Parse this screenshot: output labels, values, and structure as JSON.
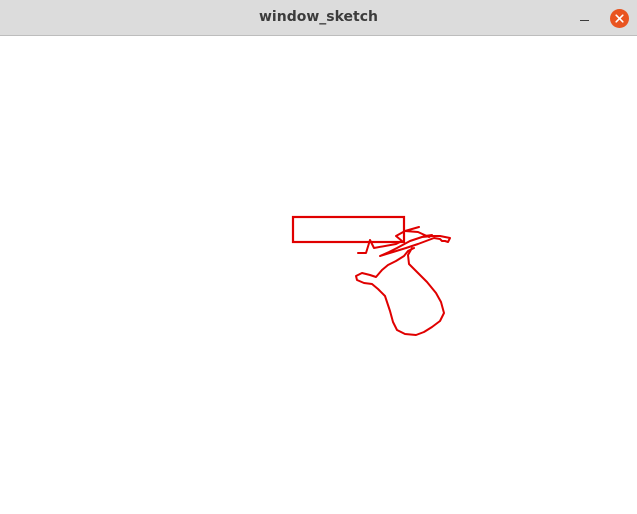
{
  "window": {
    "title": "window_sketch"
  },
  "titlebar": {
    "minimize_icon": "minimize-icon",
    "close_icon": "close-icon"
  },
  "sketch": {
    "stroke_color": "#e00000",
    "close_button_color": "#e95420"
  }
}
